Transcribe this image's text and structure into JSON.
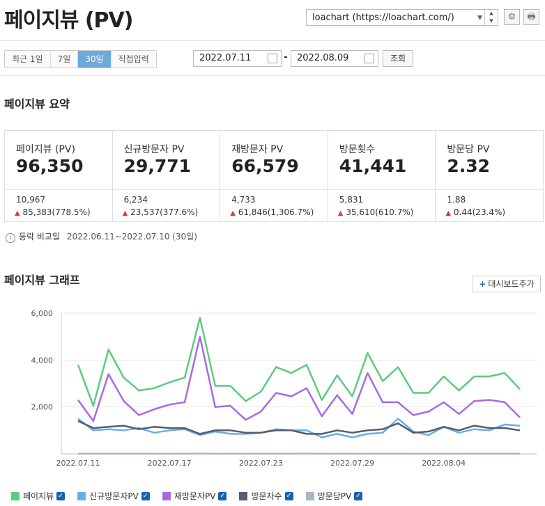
{
  "page": {
    "title": "페이지뷰 (PV)"
  },
  "site_select": {
    "value": "loachart (https://loachart.com/)"
  },
  "header_icons": {
    "settings": "gear-icon",
    "print": "print-icon"
  },
  "period_tabs": [
    {
      "label": "최근 1일"
    },
    {
      "label": "7일"
    },
    {
      "label": "30일"
    },
    {
      "label": "직접입력"
    }
  ],
  "active_tab": "30일",
  "date_range": {
    "start": "2022.07.11",
    "end": "2022.08.09",
    "separator": "-",
    "query_label": "조회"
  },
  "summary": {
    "title": "페이지뷰 요약",
    "cards": [
      {
        "label": "페이지뷰 (PV)",
        "value": "96,350",
        "prev": "10,967",
        "change": "85,383(778.5%)"
      },
      {
        "label": "신규방문자 PV",
        "value": "29,771",
        "prev": "6,234",
        "change": "23,537(377.6%)"
      },
      {
        "label": "재방문자 PV",
        "value": "66,579",
        "prev": "4,733",
        "change": "61,846(1,306.7%)"
      },
      {
        "label": "방문횟수",
        "value": "41,441",
        "prev": "5,831",
        "change": "35,610(610.7%)"
      },
      {
        "label": "방문당 PV",
        "value": "2.32",
        "prev": "1.88",
        "change": "0.44(23.4%)"
      }
    ],
    "compare_label": "등락 비교일",
    "compare_period": "2022.06.11~2022.07.10 (30일)"
  },
  "graph": {
    "title": "페이지뷰 그래프",
    "dashboard_button": "대시보드추가"
  },
  "colors": {
    "accent": "#6fa8dc",
    "up_arrow": "#e53935",
    "pv": "#5ccb7e",
    "new_pv": "#6aaee8",
    "return_pv": "#a66be0",
    "visits": "#555c6e",
    "pv_per_visit": "#a9b4c8"
  },
  "chart_data": {
    "type": "line",
    "x": [
      "2022.07.11",
      "2022.07.12",
      "2022.07.13",
      "2022.07.14",
      "2022.07.15",
      "2022.07.16",
      "2022.07.17",
      "2022.07.18",
      "2022.07.19",
      "2022.07.20",
      "2022.07.21",
      "2022.07.22",
      "2022.07.23",
      "2022.07.24",
      "2022.07.25",
      "2022.07.26",
      "2022.07.27",
      "2022.07.28",
      "2022.07.29",
      "2022.07.30",
      "2022.07.31",
      "2022.08.01",
      "2022.08.02",
      "2022.08.03",
      "2022.08.04",
      "2022.08.05",
      "2022.08.06",
      "2022.08.07",
      "2022.08.08",
      "2022.08.09"
    ],
    "x_tick_labels": [
      "2022.07.11",
      "2022.07.17",
      "2022.07.23",
      "2022.07.29",
      "2022.08.04"
    ],
    "y_ticks": [
      "2,000",
      "4,000",
      "6,000"
    ],
    "ylim": [
      0,
      6000
    ],
    "grid": true,
    "legend_position": "bottom",
    "series": [
      {
        "name": "페이지뷰",
        "color": "#5ccb7e",
        "values": [
          3800,
          2050,
          4450,
          3250,
          2700,
          2800,
          3050,
          3250,
          5800,
          2900,
          2900,
          2250,
          2650,
          3700,
          3450,
          3800,
          2300,
          3350,
          2450,
          4300,
          3100,
          3700,
          2600,
          2600,
          3300,
          2700,
          3300,
          3300,
          3450,
          2750
        ]
      },
      {
        "name": "신규방문자PV",
        "color": "#6aaee8",
        "values": [
          1500,
          1000,
          1050,
          1000,
          1100,
          900,
          1000,
          1050,
          800,
          950,
          850,
          850,
          900,
          1050,
          1000,
          1000,
          700,
          850,
          700,
          850,
          900,
          1500,
          950,
          800,
          1150,
          900,
          1050,
          1000,
          1250,
          1200
        ]
      },
      {
        "name": "재방문자PV",
        "color": "#a66be0",
        "values": [
          2300,
          1400,
          3400,
          2250,
          1650,
          1900,
          2100,
          2200,
          5000,
          2000,
          2050,
          1450,
          1800,
          2600,
          2450,
          2800,
          1600,
          2500,
          1700,
          3450,
          2200,
          2200,
          1650,
          1800,
          2200,
          1700,
          2250,
          2300,
          2200,
          1550
        ]
      },
      {
        "name": "방문자수",
        "color": "#555c6e",
        "values": [
          1400,
          1100,
          1150,
          1200,
          1050,
          1150,
          1100,
          1100,
          850,
          1000,
          1000,
          900,
          900,
          1000,
          1000,
          850,
          850,
          1000,
          900,
          1000,
          1050,
          1300,
          900,
          950,
          1150,
          1000,
          1200,
          1100,
          1100,
          1000
        ]
      },
      {
        "name": "방문당PV",
        "color": "#a9b4c8",
        "values": [
          2.7,
          1.9,
          3.9,
          2.7,
          2.6,
          2.4,
          2.8,
          3.0,
          6.8,
          2.9,
          2.9,
          2.5,
          2.9,
          3.7,
          3.5,
          4.5,
          2.7,
          3.4,
          2.7,
          4.3,
          3.0,
          2.8,
          2.9,
          2.7,
          2.9,
          2.7,
          2.8,
          3.0,
          3.1,
          2.8
        ]
      }
    ]
  }
}
